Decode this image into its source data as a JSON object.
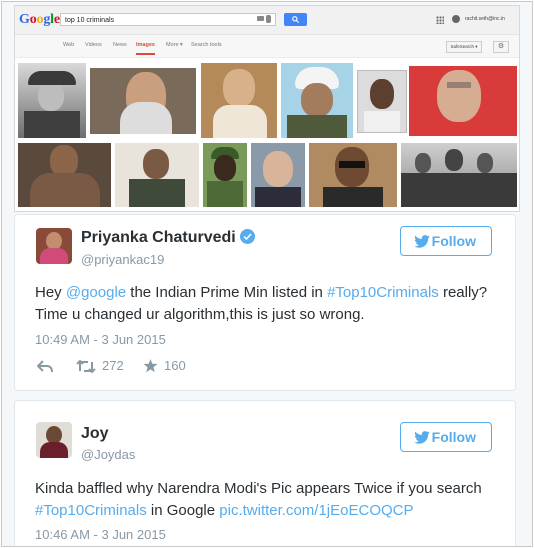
{
  "google": {
    "logo": "Google",
    "query": "top 10 criminals",
    "user": "rachit.seth@inc.in",
    "nav": [
      "Web",
      "Videos",
      "News",
      "Images",
      "More ▾",
      "Search tools"
    ],
    "active_tab": "Images",
    "safe_search": "SafeSearch ▾",
    "colors": {
      "search_button": "#4285f4",
      "active_tab": "#dd4b39"
    }
  },
  "tweets": [
    {
      "name": "Priyanka Chaturvedi",
      "verified": true,
      "handle": "@priyankac19",
      "follow_label": "Follow",
      "text_parts": [
        "Hey ",
        "@google",
        " the Indian Prime Min listed in ",
        "#Top10Criminals",
        " really? Time u changed ur algorithm,this is just so wrong."
      ],
      "timestamp": "10:49 AM - 3 Jun 2015",
      "retweets": "272",
      "favorites": "160"
    },
    {
      "name": "Joy",
      "verified": false,
      "handle": "@Joydas",
      "follow_label": "Follow",
      "text_parts": [
        "Kinda baffled why Narendra Modi's Pic appears Twice if you search ",
        "#Top10Criminals",
        " in Google ",
        "pic.twitter.com/1jEoECOQCP"
      ],
      "timestamp": "10:46 AM - 3 Jun 2015"
    }
  ],
  "colors": {
    "accent": "#55acee",
    "text": "#292f33",
    "muted": "#8899a6"
  }
}
